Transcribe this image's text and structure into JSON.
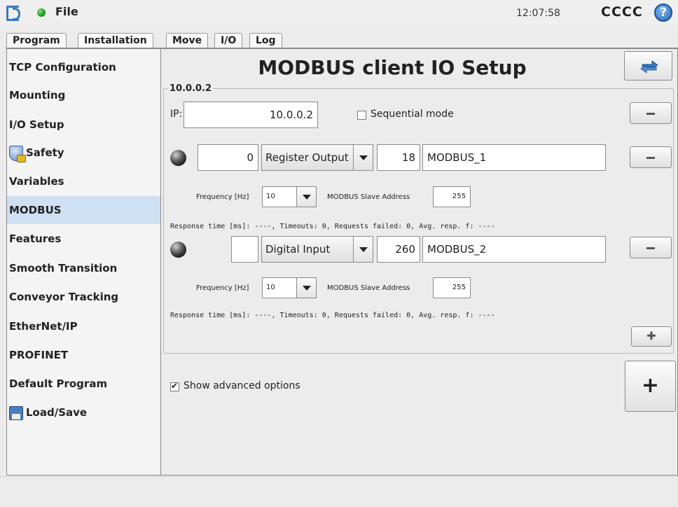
{
  "header": {
    "file_label": "File",
    "time": "12:07:58",
    "robot_name": "CCCC",
    "help_label": "?"
  },
  "tabs": [
    {
      "label": "Program"
    },
    {
      "label": "Installation"
    },
    {
      "label": "Move"
    },
    {
      "label": "I/O"
    },
    {
      "label": "Log"
    }
  ],
  "sidebar": {
    "items": [
      {
        "label": "TCP Configuration"
      },
      {
        "label": "Mounting"
      },
      {
        "label": "I/O Setup"
      },
      {
        "label": "Safety"
      },
      {
        "label": "Variables"
      },
      {
        "label": "MODBUS"
      },
      {
        "label": "Features"
      },
      {
        "label": "Smooth Transition"
      },
      {
        "label": "Conveyor Tracking"
      },
      {
        "label": "EtherNet/IP"
      },
      {
        "label": "PROFINET"
      },
      {
        "label": "Default Program"
      },
      {
        "label": "Load/Save"
      }
    ]
  },
  "main": {
    "title": "MODBUS client IO Setup",
    "group_title": "10.0.0.2",
    "ip_label": "IP:",
    "ip_value": "10.0.0.2",
    "sequential_label": "Sequential mode",
    "signals": [
      {
        "value": "0",
        "type": "Register Output",
        "address": "18",
        "name": "MODBUS_1",
        "freq_label": "Frequency [Hz]",
        "freq_value": "10",
        "slave_label": "MODBUS Slave Address",
        "slave_value": "255",
        "status": "Response time [ms]: ----, Timeouts: 0, Requests failed: 0, Avg. resp. f: ----"
      },
      {
        "value": "",
        "type": "Digital Input",
        "address": "260",
        "name": "MODBUS_2",
        "freq_label": "Frequency [Hz]",
        "freq_value": "10",
        "slave_label": "MODBUS Slave Address",
        "slave_value": "255",
        "status": "Response time [ms]: ----, Timeouts: 0, Requests failed: 0, Avg. resp. f: ----"
      }
    ],
    "advanced_label": "Show advanced options",
    "add_small_label": "✚",
    "add_big_label": "+"
  }
}
